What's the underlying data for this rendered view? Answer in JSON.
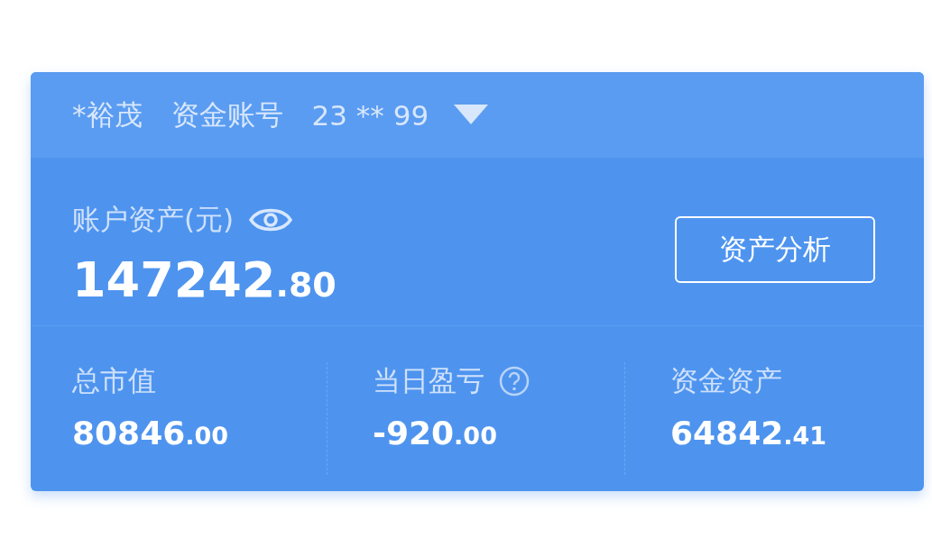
{
  "account_bar": {
    "name": "*裕茂",
    "label": "资金账号",
    "number": "23 ** 99"
  },
  "total_assets": {
    "label": "账户资产(元)",
    "integer": "147242",
    "fraction": ".80",
    "button": "资产分析"
  },
  "stats": [
    {
      "label": "总市值",
      "help": false,
      "integer": "80846",
      "fraction": ".00"
    },
    {
      "label": "当日盈亏",
      "help": true,
      "integer": "-920",
      "fraction": ".00"
    },
    {
      "label": "资金资产",
      "help": false,
      "integer": "64842",
      "fraction": ".41"
    }
  ]
}
